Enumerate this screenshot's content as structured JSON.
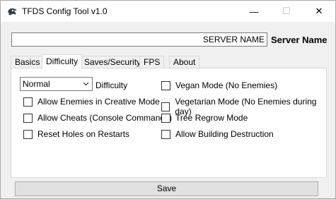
{
  "window": {
    "title": "TFDS Config Tool v1.0",
    "controls": {
      "minimize": "—",
      "maximize": "☐",
      "close": "✕"
    }
  },
  "server": {
    "value": "SERVER NAME",
    "label": "Server Name"
  },
  "tabs": [
    {
      "label": "Basics",
      "active": false
    },
    {
      "label": "Difficulty",
      "active": true
    },
    {
      "label": "Saves/Security",
      "active": false
    },
    {
      "label": "FPS",
      "active": false
    },
    {
      "label": "About",
      "active": false
    }
  ],
  "difficulty": {
    "selected": "Normal",
    "label": "Difficulty"
  },
  "options_left": [
    {
      "label": "Allow Enemies in Creative Mode",
      "checked": false
    },
    {
      "label": "Allow Cheats (Console Commands)",
      "checked": false
    },
    {
      "label": "Reset Holes on Restarts",
      "checked": false
    }
  ],
  "options_right": [
    {
      "label": "Vegan Mode (No Enemies)",
      "checked": false
    },
    {
      "label": "Vegetarian Mode (No Enemies during day)",
      "checked": false
    },
    {
      "label": "Tree Regrow Mode",
      "checked": false
    },
    {
      "label": "Allow Building Destruction",
      "checked": false
    }
  ],
  "actions": {
    "save": "Save"
  },
  "colors": {
    "accent": "#0078d7",
    "background": "#f0f0f0",
    "panel": "#ffffff"
  }
}
